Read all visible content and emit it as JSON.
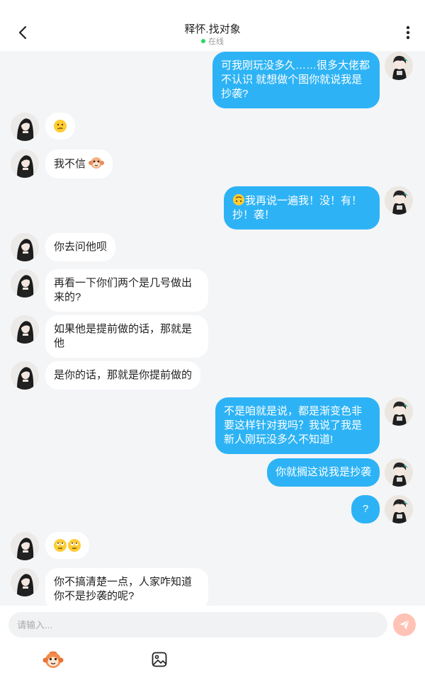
{
  "header": {
    "title": "释怀.找对象",
    "status_text": "在线"
  },
  "messages": [
    {
      "side": "me",
      "text": "可我刚玩没多久……很多大佬都不认识 就想做个图你就说我是抄袭?"
    },
    {
      "side": "peer",
      "emoji": "confused-face"
    },
    {
      "side": "peer",
      "text": "我不信",
      "emoji": "monkey-face"
    },
    {
      "side": "me",
      "text": "我再说一遍我！没！有！抄！袭！",
      "emoji": "upside-down-face"
    },
    {
      "side": "peer",
      "text": "你去问他呗"
    },
    {
      "side": "peer",
      "text": "再看一下你们两个是几号做出来的?"
    },
    {
      "side": "peer",
      "text": "如果他是提前做的话，那就是他"
    },
    {
      "side": "peer",
      "text": "是你的话，那就是你提前做的"
    },
    {
      "side": "me",
      "text": "不是咱就是说，都是渐变色非要这样针对我吗？我说了我是新人刚玩没多久不知道!"
    },
    {
      "side": "me",
      "text": "你就搁这说我是抄袭"
    },
    {
      "side": "me",
      "text": "?"
    },
    {
      "side": "peer",
      "emoji": "eye-roll-face x2"
    },
    {
      "side": "peer",
      "text": "你不搞清楚一点，人家咋知道你不是抄袭的呢?"
    }
  ],
  "input": {
    "placeholder": "请输入..."
  },
  "colors": {
    "my_bubble": "#2db3f5",
    "peer_bubble": "#ffffff",
    "background": "#f4f5f7",
    "online_dot": "#2ed36b",
    "send_button": "#ffc2b5"
  },
  "icons": [
    "back-arrow-icon",
    "more-vertical-icon",
    "send-icon",
    "sticker-icon",
    "image-icon"
  ]
}
